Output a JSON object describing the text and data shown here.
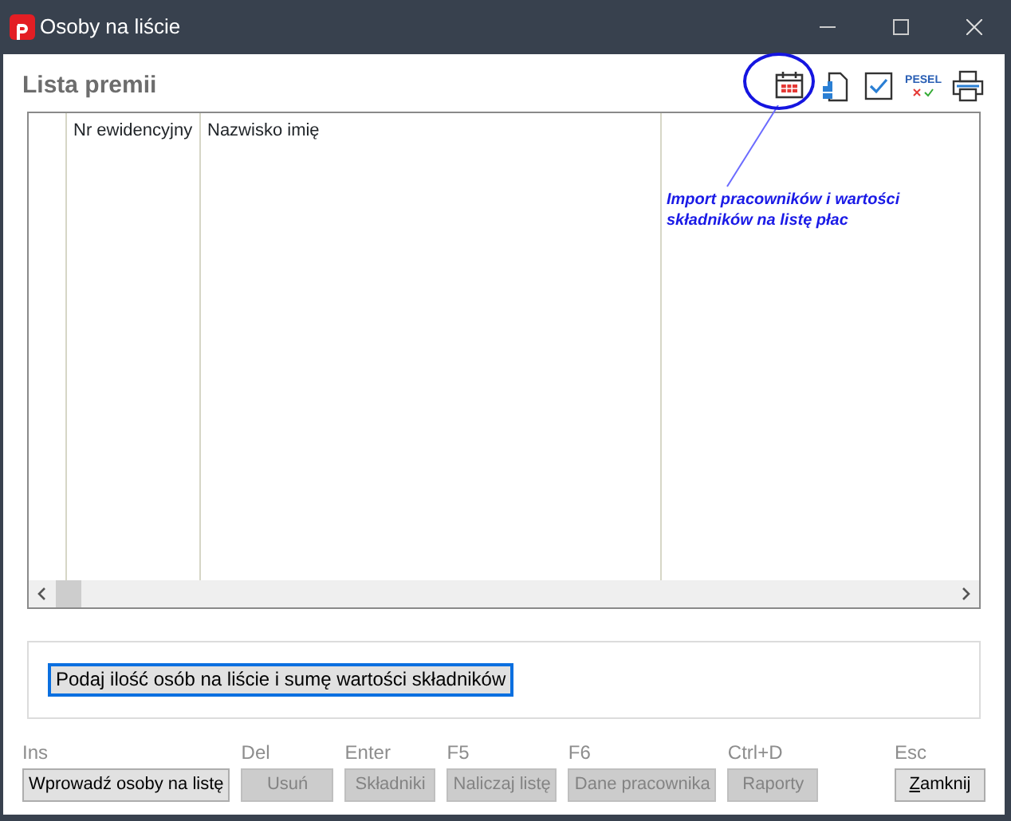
{
  "window": {
    "title": "Osoby na liście"
  },
  "list_title": "Lista premii",
  "toolbar": [
    {
      "kind": "calendar"
    },
    {
      "kind": "chart-doc"
    },
    {
      "kind": "check"
    },
    {
      "kind": "pesel",
      "label": "PESEL"
    },
    {
      "kind": "print"
    }
  ],
  "annotation": "Import pracowników i wartości składników na listę płac",
  "table": {
    "columns": [
      "Nr ewidencyjny",
      "Nazwisko imię"
    ]
  },
  "summary_button": {
    "label": "Podaj ilość osób na liście i sumę wartości składników",
    "focused": true
  },
  "buttons": [
    {
      "shortcut": "Ins",
      "label": "Wprowadź osoby na listę",
      "disabled": false,
      "mnemonic": false
    },
    {
      "shortcut": "Del",
      "label": "Usuń",
      "disabled": true,
      "mnemonic": false
    },
    {
      "shortcut": "Enter",
      "label": "Składniki",
      "disabled": true,
      "mnemonic": false
    },
    {
      "shortcut": "F5",
      "label": "Naliczaj listę",
      "disabled": true,
      "mnemonic": false
    },
    {
      "shortcut": "F6",
      "label": "Dane pracownika",
      "disabled": true,
      "mnemonic": false
    },
    {
      "shortcut": "Ctrl+D",
      "label": "Raporty",
      "disabled": true,
      "mnemonic": false
    },
    {
      "shortcut": "Esc",
      "label": "Zamknij",
      "disabled": false,
      "mnemonic": true
    }
  ]
}
